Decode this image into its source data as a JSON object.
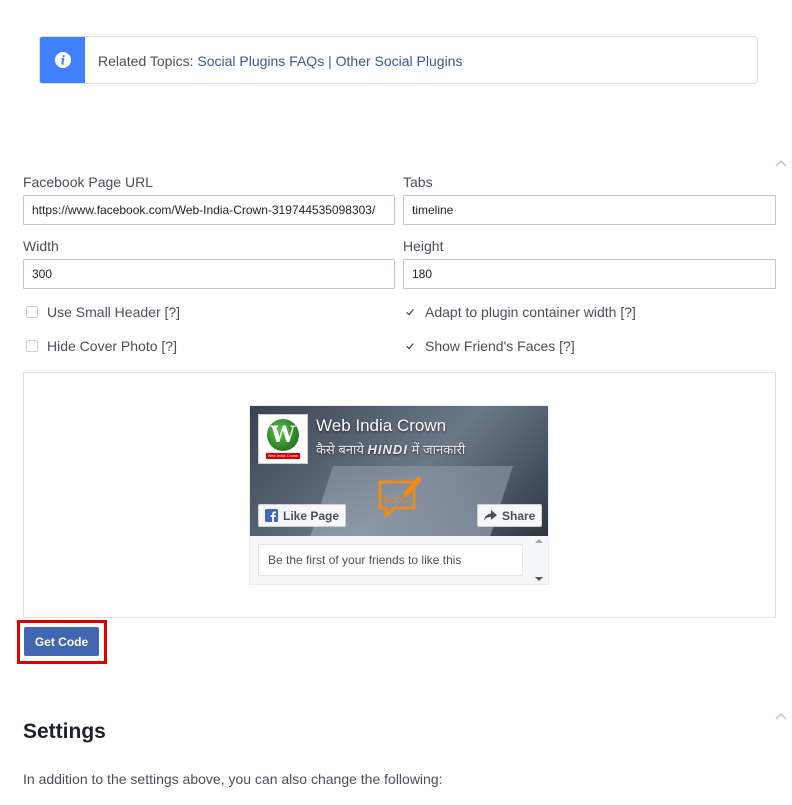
{
  "related_topics": {
    "prefix": "Related Topics: ",
    "link1": "Social Plugins FAQs",
    "separator": " | ",
    "link2": "Other Social Plugins",
    "icon": "info-icon"
  },
  "form": {
    "page_url_label": "Facebook Page URL",
    "page_url_value": "https://www.facebook.com/Web-India-Crown-319744535098303/",
    "tabs_label": "Tabs",
    "tabs_value": "timeline",
    "width_label": "Width",
    "width_value": "300",
    "height_label": "Height",
    "height_value": "180",
    "checkboxes": [
      {
        "label": "Use Small Header [?]",
        "checked": false
      },
      {
        "label": "Adapt to plugin container width [?]",
        "checked": true
      },
      {
        "label": "Hide Cover Photo [?]",
        "checked": false
      },
      {
        "label": "Show Friend's Faces [?]",
        "checked": true
      }
    ]
  },
  "preview": {
    "page_name": "Web India Crown",
    "tagline_pre": "कैसे बनाये ",
    "tagline_bold": "HINDI",
    "tagline_post": " में जानकारी",
    "avatar_letter": "W",
    "avatar_caption": "Web India Crown",
    "blog_text": "BLOG",
    "like_label": "Like Page",
    "share_label": "Share",
    "feed_text": "Be the first of your friends to like this"
  },
  "get_code_label": "Get Code",
  "settings": {
    "title": "Settings",
    "description": "In addition to the settings above, you can also change the following:"
  },
  "colors": {
    "accent": "#4267b2",
    "info_blue": "#4080ff",
    "link": "#365899",
    "highlight_red": "#e00000"
  }
}
